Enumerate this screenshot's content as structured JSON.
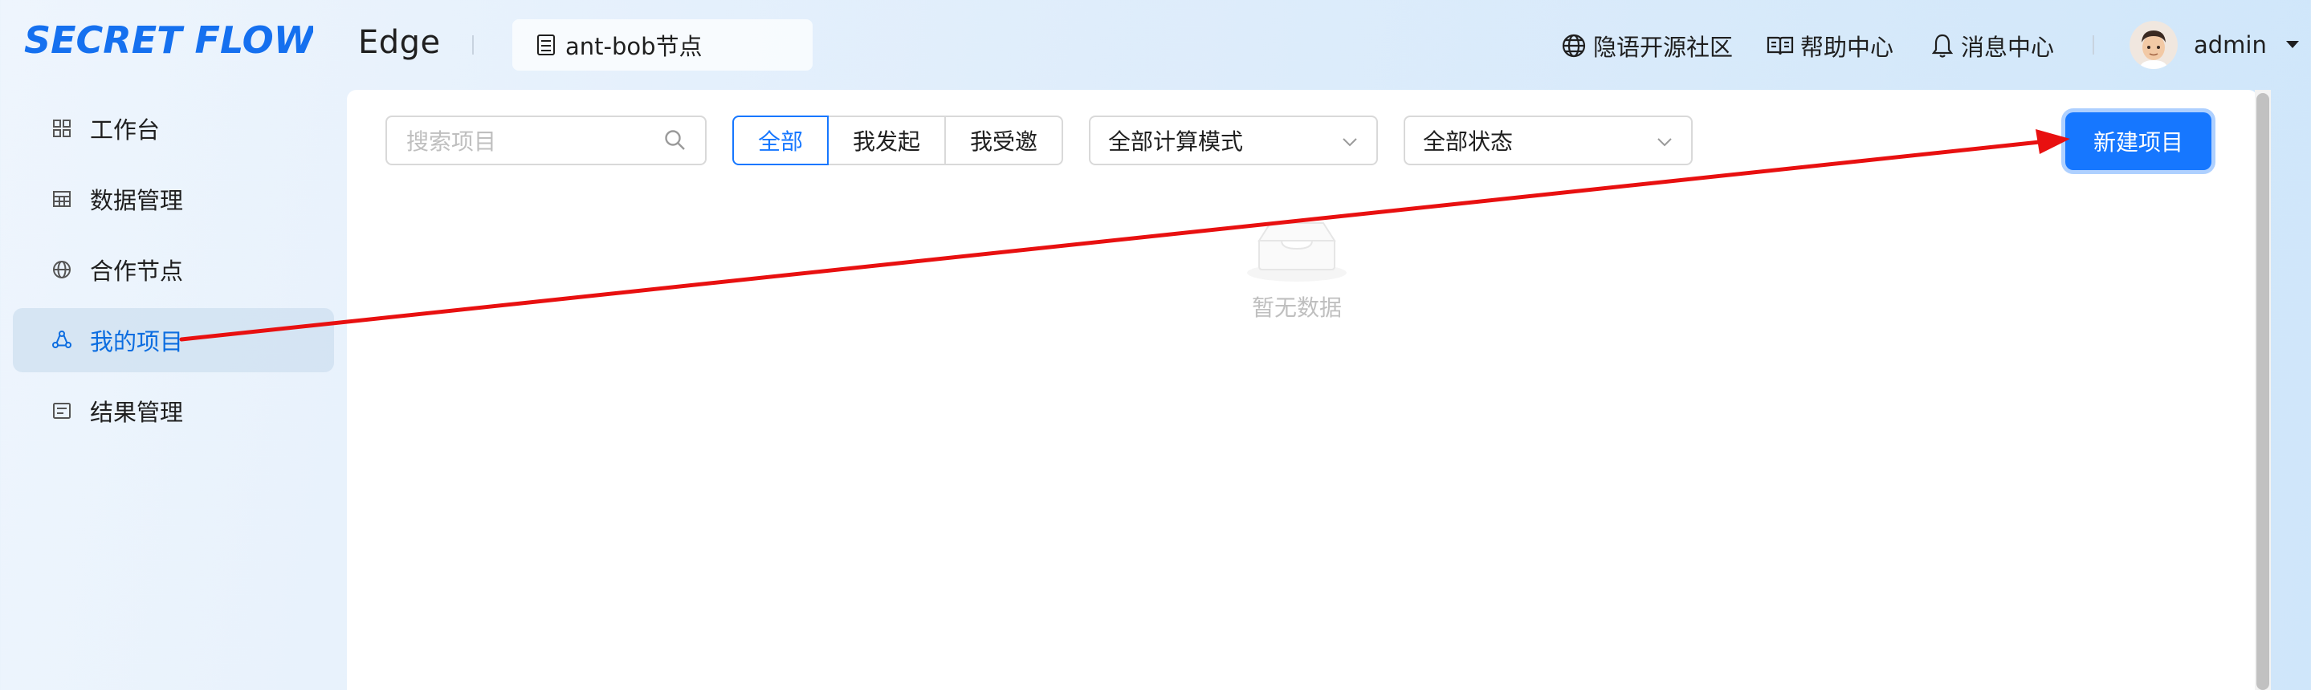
{
  "header": {
    "logo_text": "SECRET FLOW",
    "product_name": "Edge",
    "node_name": "ant-bob节点",
    "links": [
      {
        "label": "隐语开源社区",
        "icon": "globe-icon"
      },
      {
        "label": "帮助中心",
        "icon": "book-icon"
      },
      {
        "label": "消息中心",
        "icon": "bell-icon"
      }
    ],
    "user": {
      "name": "admin"
    }
  },
  "sidebar": {
    "items": [
      {
        "label": "工作台",
        "icon": "grid-icon",
        "active": false
      },
      {
        "label": "数据管理",
        "icon": "table-icon",
        "active": false
      },
      {
        "label": "合作节点",
        "icon": "globe-icon",
        "active": false
      },
      {
        "label": "我的项目",
        "icon": "project-icon",
        "active": true
      },
      {
        "label": "结果管理",
        "icon": "list-icon",
        "active": false
      }
    ]
  },
  "toolbar": {
    "search_placeholder": "搜索项目",
    "filter_tabs": [
      "全部",
      "我发起",
      "我受邀"
    ],
    "active_filter": "全部",
    "compute_mode_select": "全部计算模式",
    "status_select": "全部状态",
    "new_project_label": "新建项目"
  },
  "content": {
    "empty_text": "暂无数据"
  },
  "colors": {
    "accent": "#1677ff",
    "annotation_arrow": "#e81010",
    "active_menu_text": "#0c6de0"
  }
}
